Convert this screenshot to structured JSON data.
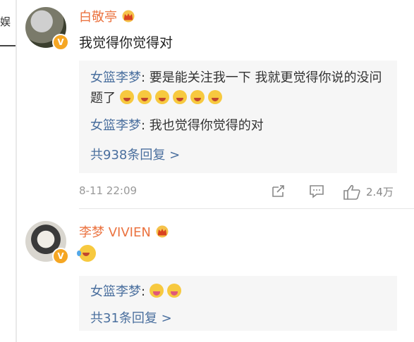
{
  "left_strip": {
    "text": "娱"
  },
  "comments": [
    {
      "username": "白敬亭",
      "text": "我觉得你觉得对",
      "replies": [
        {
          "name": "女篮李梦",
          "text": "要是能关注我一下  我就更觉得你说的没问题了"
        },
        {
          "name": "女篮李梦",
          "text": "我也觉得你觉得的对"
        }
      ],
      "more_replies": "共938条回复 >",
      "timestamp": "8-11 22:09",
      "like_count": "2.4万"
    },
    {
      "username": "李梦 VIVIEN",
      "replies": [
        {
          "name": "女篮李梦",
          "text": ""
        }
      ],
      "more_replies": "共31条回复 >"
    }
  ],
  "icons": {
    "verified": "verified-badge-icon",
    "crown": "crown-member-icon",
    "share": "share-icon",
    "comment": "comment-icon",
    "like": "like-icon"
  },
  "colors": {
    "username": "#eb7340",
    "reply_name": "#4a6f9e",
    "reply_bg": "#f6f6f6",
    "meta": "#999999"
  }
}
